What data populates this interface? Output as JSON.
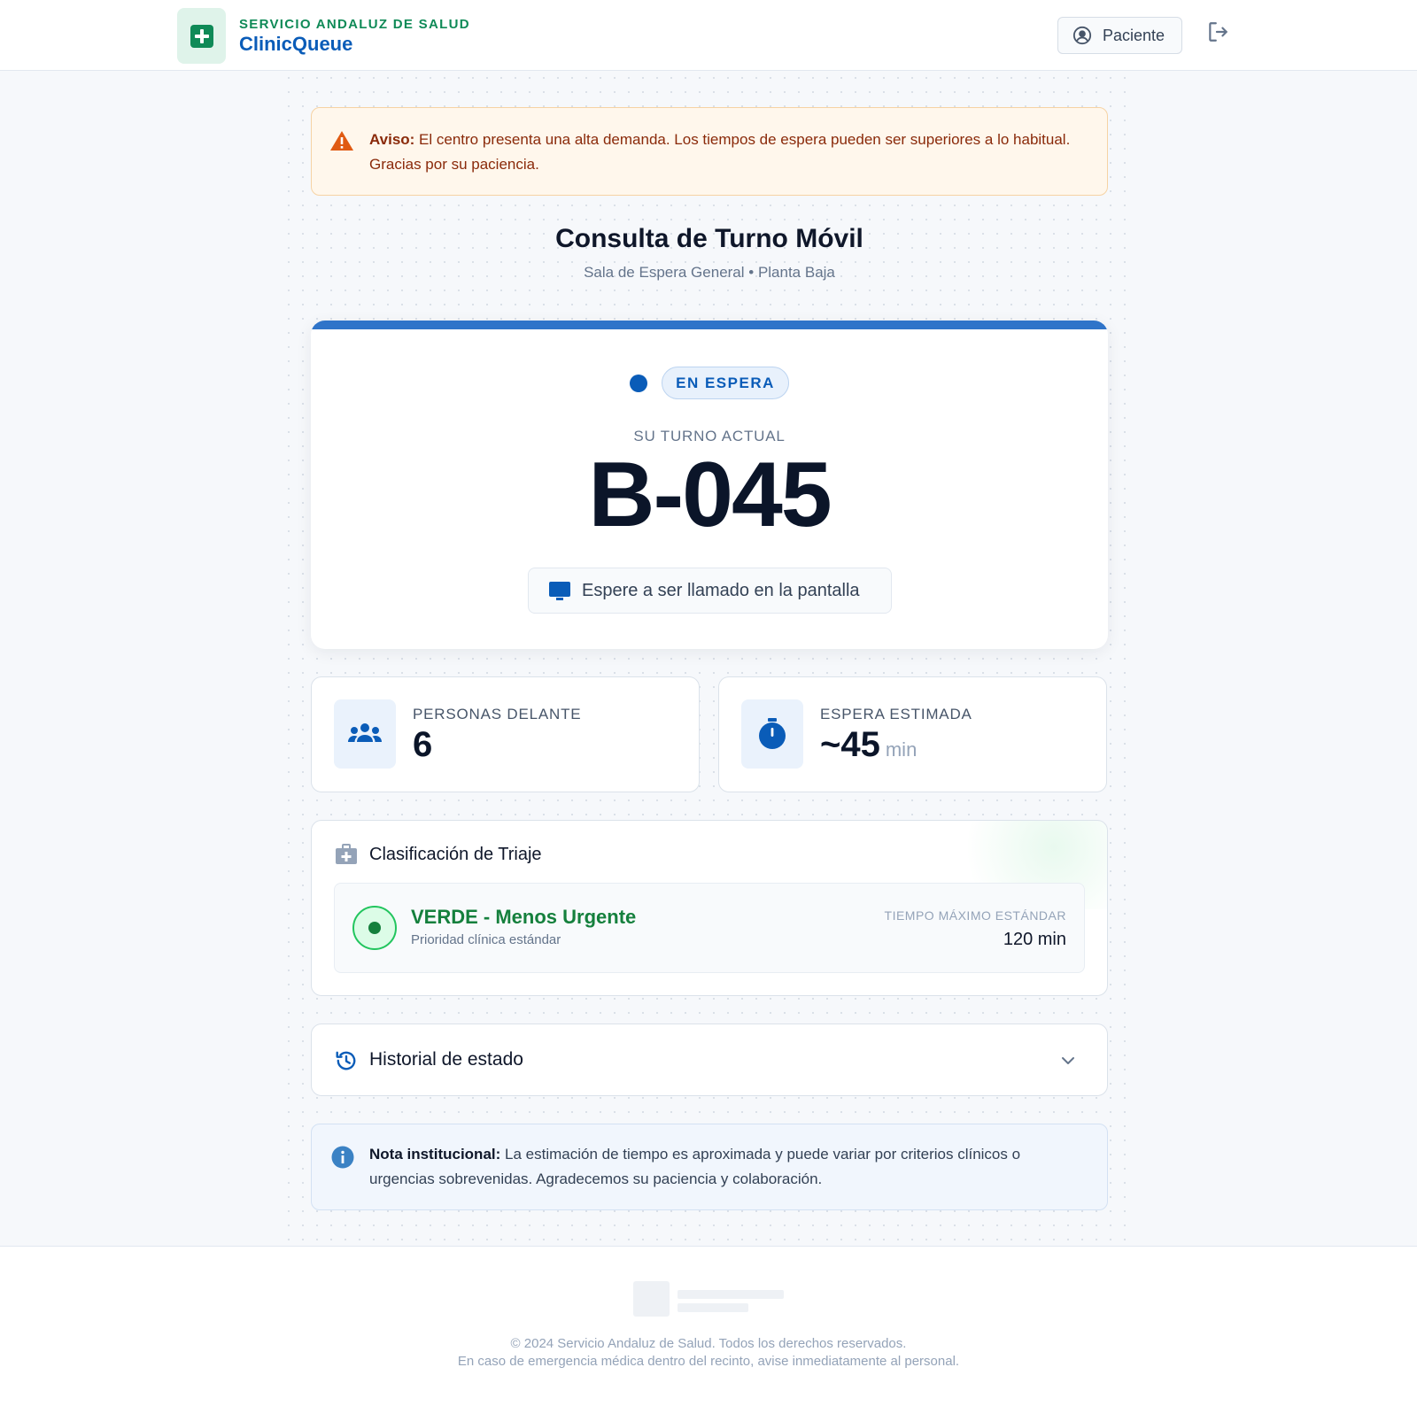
{
  "header": {
    "org": "SERVICIO ANDALUZ DE SALUD",
    "app_name": "ClinicQueue",
    "user_label": "Paciente"
  },
  "alert": {
    "title": "Aviso:",
    "text": " El centro presenta una alta demanda. Los tiempos de espera pueden ser superiores a lo habitual. Gracias por su paciencia."
  },
  "page": {
    "title": "Consulta de Turno Móvil",
    "subtitle": "Sala de Espera General • Planta Baja"
  },
  "ticket": {
    "status": "EN ESPERA",
    "label": "SU TURNO ACTUAL",
    "number": "B-045",
    "instruction": "Espere a ser llamado en la pantalla"
  },
  "stats": {
    "ahead_label": "PERSONAS DELANTE",
    "ahead_value": "6",
    "wait_label": "ESPERA ESTIMADA",
    "wait_value": "~45",
    "wait_unit": "min"
  },
  "triage": {
    "heading": "Clasificación de Triaje",
    "level": "VERDE - Menos Urgente",
    "description": "Prioridad clínica estándar",
    "max_label": "TIEMPO MÁXIMO ESTÁNDAR",
    "max_value": "120 min",
    "color": "#15803d"
  },
  "history": {
    "label": "Historial de estado"
  },
  "note": {
    "title": "Nota institucional:",
    "text": " La estimación de tiempo es aproximada y puede variar por criterios clínicos o urgencias sobrevenidas. Agradecemos su paciencia y colaboración."
  },
  "footer": {
    "copyright": "© 2024 Servicio Andaluz de Salud. Todos los derechos reservados.",
    "emergency": "En caso de emergencia médica dentro del recinto, avise inmediatamente al personal."
  },
  "colors": {
    "brand_green": "#0f8a57",
    "brand_blue": "#0a5cb8",
    "alert_bg": "#fff7ec",
    "note_bg": "#f1f6fd"
  }
}
